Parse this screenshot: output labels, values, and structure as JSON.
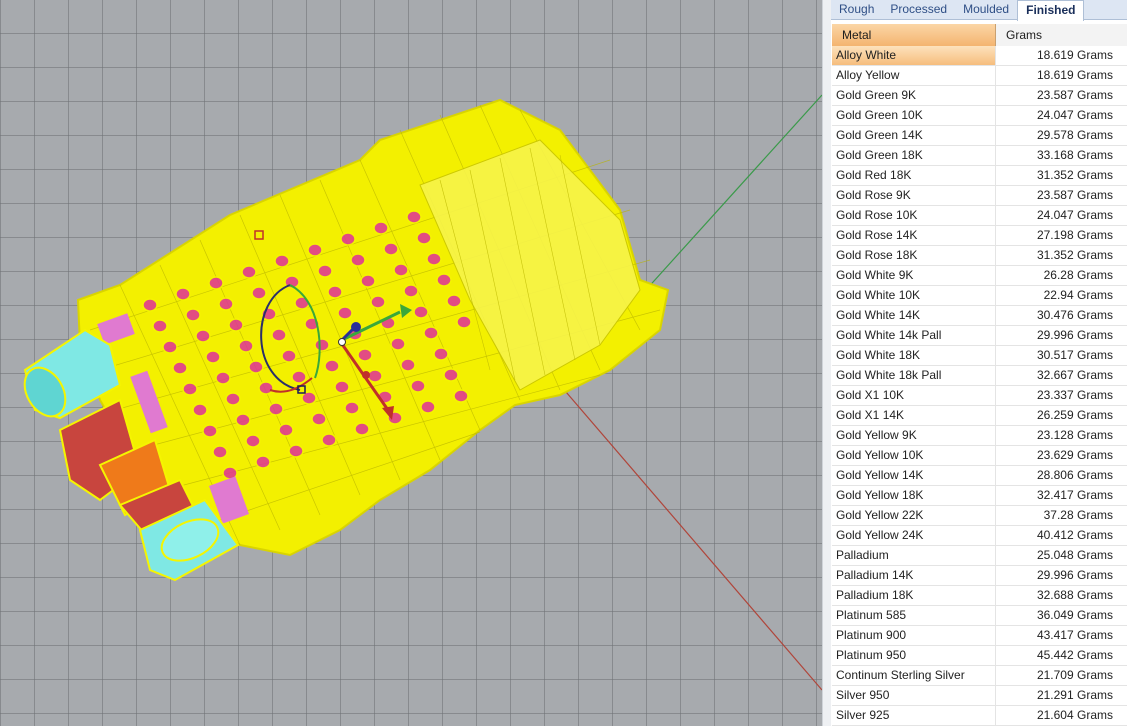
{
  "tabs": [
    {
      "label": "Rough",
      "active": false
    },
    {
      "label": "Processed",
      "active": false
    },
    {
      "label": "Moulded",
      "active": false
    },
    {
      "label": "Finished",
      "active": true
    }
  ],
  "table": {
    "headers": {
      "metal": "Metal",
      "grams": "Grams"
    },
    "selected_index": 0,
    "rows": [
      {
        "metal": "Alloy White",
        "grams": "18.619 Grams"
      },
      {
        "metal": "Alloy Yellow",
        "grams": "18.619 Grams"
      },
      {
        "metal": "Gold Green 9K",
        "grams": "23.587 Grams"
      },
      {
        "metal": "Gold Green 10K",
        "grams": "24.047 Grams"
      },
      {
        "metal": "Gold Green 14K",
        "grams": "29.578 Grams"
      },
      {
        "metal": "Gold Green 18K",
        "grams": "33.168 Grams"
      },
      {
        "metal": "Gold Red 18K",
        "grams": "31.352 Grams"
      },
      {
        "metal": "Gold Rose 9K",
        "grams": "23.587 Grams"
      },
      {
        "metal": "Gold Rose 10K",
        "grams": "24.047 Grams"
      },
      {
        "metal": "Gold Rose 14K",
        "grams": "27.198 Grams"
      },
      {
        "metal": "Gold Rose 18K",
        "grams": "31.352 Grams"
      },
      {
        "metal": "Gold White 9K",
        "grams": "26.28 Grams"
      },
      {
        "metal": "Gold White 10K",
        "grams": "22.94 Grams"
      },
      {
        "metal": "Gold White 14K",
        "grams": "30.476 Grams"
      },
      {
        "metal": "Gold White 14k Pall",
        "grams": "29.996 Grams"
      },
      {
        "metal": "Gold White 18K",
        "grams": "30.517 Grams"
      },
      {
        "metal": "Gold White 18k Pall",
        "grams": "32.667 Grams"
      },
      {
        "metal": "Gold X1 10K",
        "grams": "23.337 Grams"
      },
      {
        "metal": "Gold X1 14K",
        "grams": "26.259 Grams"
      },
      {
        "metal": "Gold Yellow 9K",
        "grams": "23.128 Grams"
      },
      {
        "metal": "Gold Yellow 10K",
        "grams": "23.629 Grams"
      },
      {
        "metal": "Gold Yellow 14K",
        "grams": "28.806 Grams"
      },
      {
        "metal": "Gold Yellow 18K",
        "grams": "32.417 Grams"
      },
      {
        "metal": "Gold Yellow 22K",
        "grams": "37.28 Grams"
      },
      {
        "metal": "Gold Yellow 24K",
        "grams": "40.412 Grams"
      },
      {
        "metal": "Palladium",
        "grams": "25.048 Grams"
      },
      {
        "metal": "Palladium 14K",
        "grams": "29.996 Grams"
      },
      {
        "metal": "Palladium 18K",
        "grams": "32.688 Grams"
      },
      {
        "metal": "Platinum 585",
        "grams": "36.049 Grams"
      },
      {
        "metal": "Platinum 900",
        "grams": "43.417 Grams"
      },
      {
        "metal": "Platinum 950",
        "grams": "45.442 Grams"
      },
      {
        "metal": "Continum Sterling Silver",
        "grams": "21.709 Grams"
      },
      {
        "metal": "Silver 950",
        "grams": "21.291 Grams"
      },
      {
        "metal": "Silver 925",
        "grams": "21.604 Grams"
      }
    ]
  },
  "viewport": {
    "model_wire_color": "#f5f500",
    "gem_color": "#e0309a",
    "axis_x_color": "#b0453a",
    "axis_y_color": "#3a9a4a",
    "gumball_icons": [
      "move-x-arrow-icon",
      "move-y-arrow-icon",
      "move-z-arrow-icon",
      "rotate-arc-icon"
    ]
  }
}
